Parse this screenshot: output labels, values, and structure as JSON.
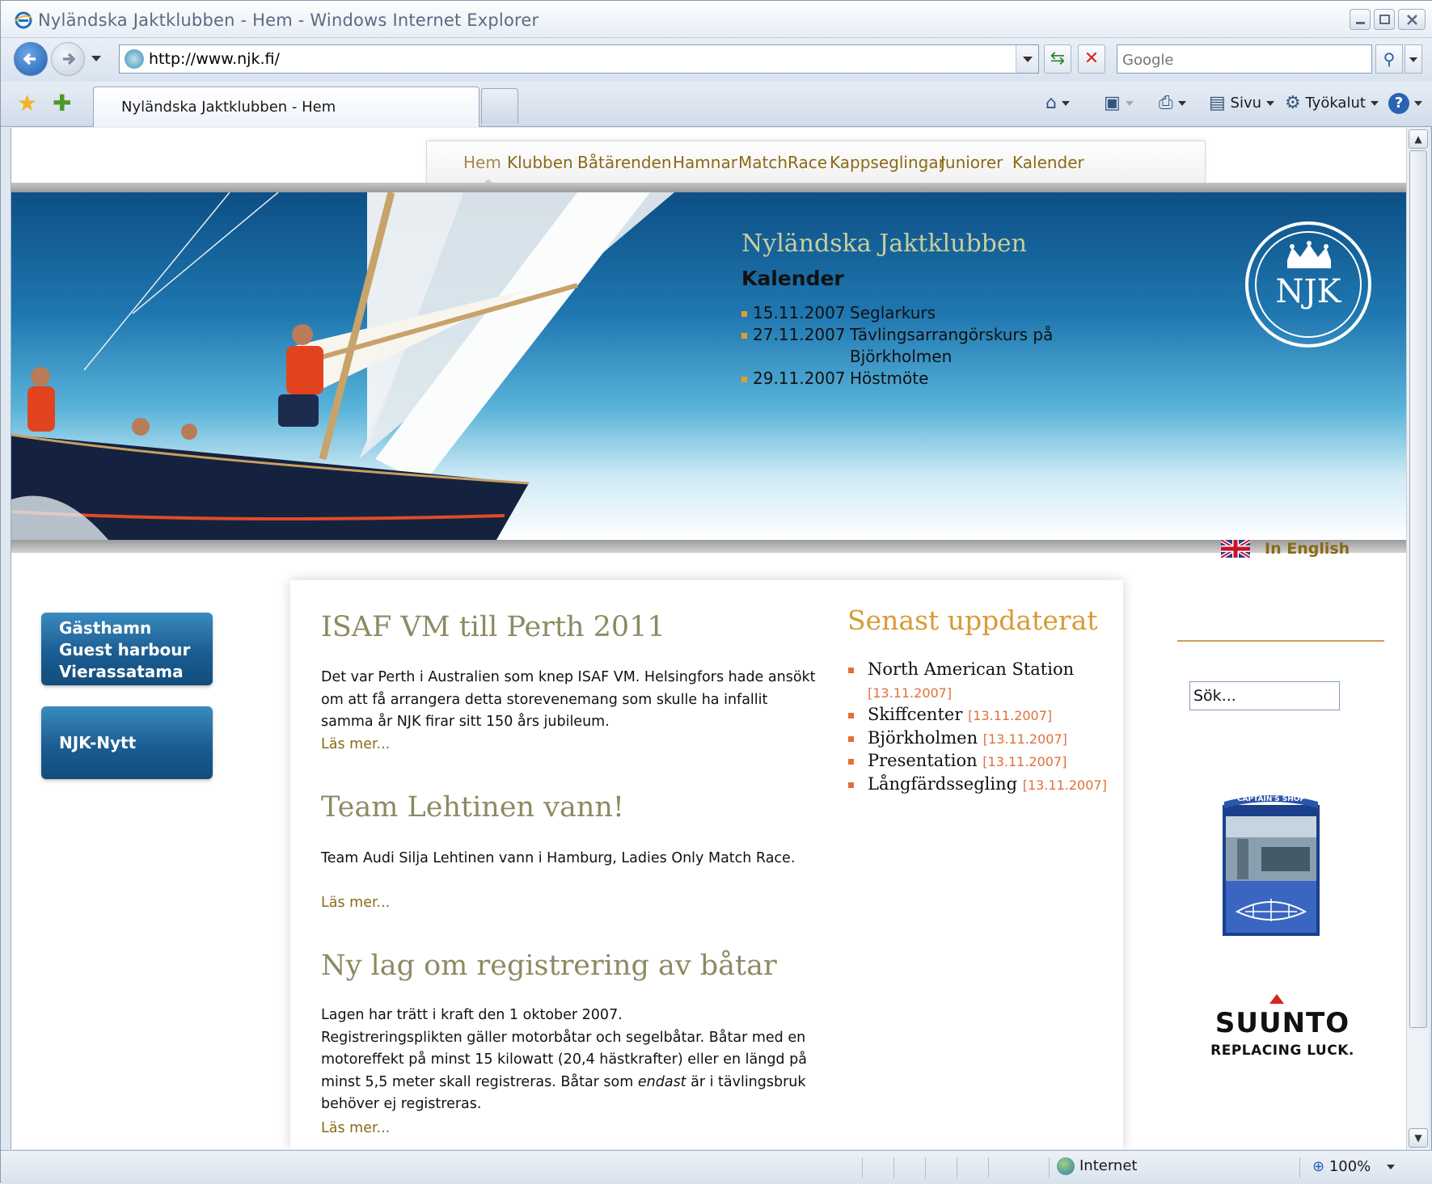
{
  "window": {
    "title": "Nyländska Jaktklubben - Hem - Windows Internet Explorer"
  },
  "addressbar": {
    "url": "http://www.njk.fi/",
    "search_placeholder": "Google"
  },
  "tabs": [
    {
      "label": "Nyländska Jaktklubben - Hem"
    }
  ],
  "commandbar": {
    "page_label": "Sivu",
    "tools_label": "Työkalut"
  },
  "statusbar": {
    "zone": "Internet",
    "zoom": "100%"
  },
  "site": {
    "menu": [
      "Hem",
      "Klubben",
      "Båtärenden",
      "Hamnar",
      "MatchRace",
      "Kappseglingar",
      "Juniorer",
      "Kalender"
    ],
    "banner": {
      "club_name": "Nyländska Jaktklubben",
      "calendar_heading": "Kalender",
      "events": [
        {
          "date": "15.11.2007",
          "title": "Seglarkurs"
        },
        {
          "date": "27.11.2007",
          "title": "Tävlingsarrangörskurs på Björkholmen"
        },
        {
          "date": "29.11.2007",
          "title": "Höstmöte"
        }
      ],
      "logo_text": "NJK"
    },
    "sidebar": {
      "harbour_lines": [
        "Gästhamn",
        "Guest harbour",
        "Vierassatama"
      ],
      "news_label": "NJK-Nytt"
    },
    "articles": [
      {
        "title": "ISAF VM till Perth 2011",
        "body": "Det var Perth i Australien som knep ISAF VM. Helsingfors hade ansökt om att få arrangera detta storevenemang som skulle ha infallit samma år NJK firar sitt 150 års jubileum.",
        "more": "Läs mer..."
      },
      {
        "title": "Team Lehtinen vann!",
        "body": "Team Audi Silja Lehtinen vann i Hamburg, Ladies Only Match Race.",
        "more": "Läs mer..."
      },
      {
        "title": "Ny lag om registrering av båtar",
        "body_line1": "Lagen har trätt i kraft den 1 oktober 2007.",
        "body_line2a": "Registreringsplikten gäller motorbåtar och segelbåtar. Båtar med en motoreffekt på minst 15 kilowatt (20,4 hästkrafter) eller en längd på minst 5,5 meter skall registreras. Båtar som ",
        "body_em": "endast",
        "body_line2b": " är i tävlingsbruk behöver ej registreras.",
        "more": "Läs mer..."
      }
    ],
    "updated": {
      "heading": "Senast uppdaterat",
      "items": [
        {
          "title": "North American Station",
          "date": "[13.11.2007]"
        },
        {
          "title": "Skiffcenter",
          "date": "[13.11.2007]"
        },
        {
          "title": "Björkholmen",
          "date": "[13.11.2007]"
        },
        {
          "title": "Presentation",
          "date": "[13.11.2007]"
        },
        {
          "title": "Långfärdssegling",
          "date": "[13.11.2007]"
        }
      ]
    },
    "right": {
      "english_label": "In English",
      "search_value": "Sök...",
      "shop_label": "CAPTAIN'S SHOP",
      "suunto_brand": "SUUNTO",
      "suunto_tagline": "REPLACING LUCK."
    }
  }
}
